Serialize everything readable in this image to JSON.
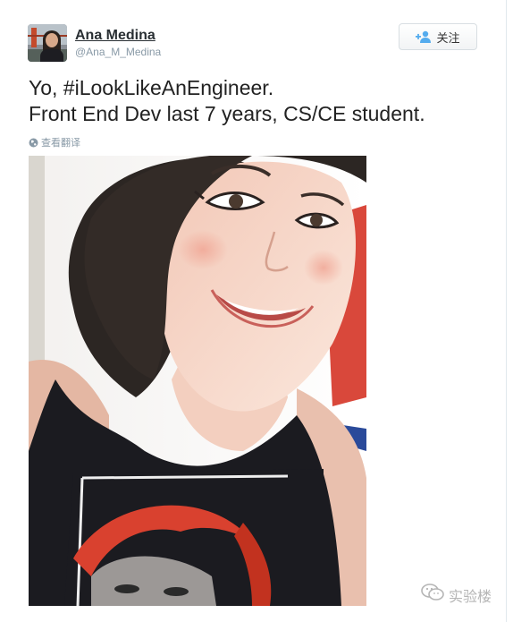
{
  "user": {
    "name": "Ana Medina",
    "handle": "@Ana_M_Medina"
  },
  "follow_button": {
    "label": "关注",
    "icon": "add-user-icon"
  },
  "tweet": {
    "line1": "Yo, #iLookLikeAnEngineer.",
    "line2": "Front End Dev last 7 years, CS/CE student.",
    "translate_label": "查看翻译",
    "translate_icon": "globe-icon"
  },
  "watermark": {
    "text": "实验楼",
    "icon": "wechat-icon"
  },
  "colors": {
    "name": "#292f33",
    "handle": "#8899a6",
    "text": "#222222",
    "follow_icon": "#55acee"
  }
}
